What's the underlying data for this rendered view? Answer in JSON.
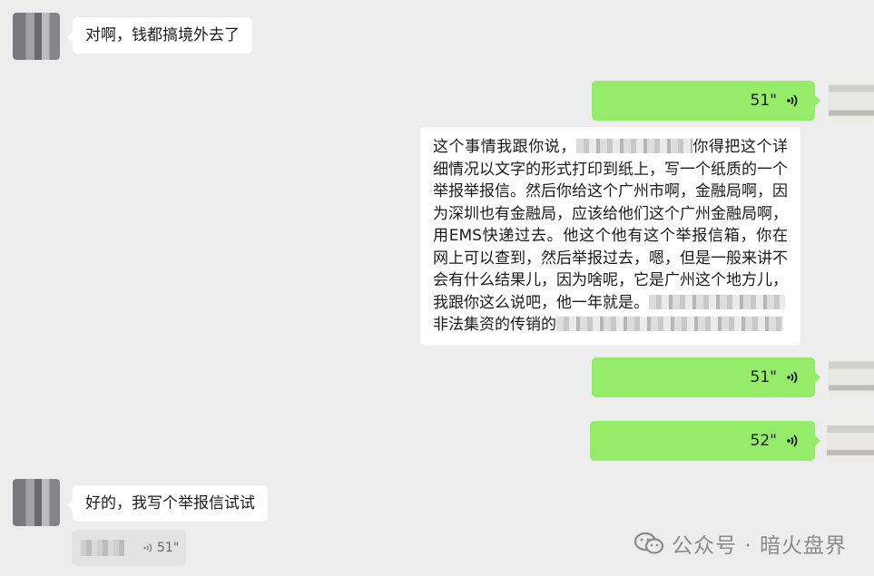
{
  "messages": {
    "m1": {
      "text": "对啊，钱都搞境外去了"
    },
    "m2": {
      "duration": "51\""
    },
    "m3": {
      "parts": [
        "这个事情我跟你说，",
        "你得把这个详细情况以文字的形式打印到纸上，写一个纸质的一个举报举报信。然后你给这个广州市啊，金融局啊，因为深圳也有金融局，应该给他们这个广州金融局啊，用EMS快递过去。他这个他有这个举报信箱，你在网上可以查到，然后举报过去，嗯，但是一般来讲不会有什么结果儿，因为啥呢，它是广州这个地方儿，我跟你这么说吧，他一年就是。",
        "非法集资的传销的"
      ]
    },
    "m4": {
      "duration": "51\""
    },
    "m5": {
      "duration": "52\""
    },
    "m6": {
      "text": "好的，我写个举报信试试"
    },
    "quote": {
      "duration": "51\""
    }
  },
  "watermark": {
    "text": "公众号 · 暗火盘界"
  },
  "colors": {
    "background": "#ededed",
    "sent_bubble": "#95ec69",
    "received_bubble": "#ffffff"
  }
}
